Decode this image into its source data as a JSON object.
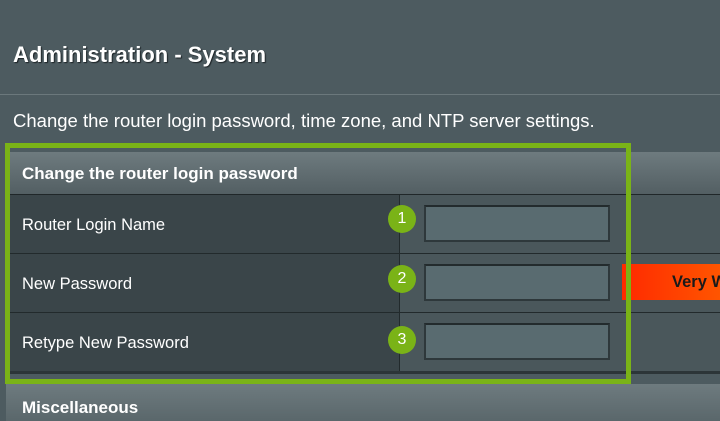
{
  "page": {
    "title": "Administration - System",
    "description": "Change the router login password, time zone, and NTP server settings."
  },
  "password_section": {
    "title": "Change the router login password",
    "rows": [
      {
        "label": "Router Login Name",
        "value": "",
        "step": "1"
      },
      {
        "label": "New Password",
        "value": "",
        "step": "2"
      },
      {
        "label": "Retype New Password",
        "value": "",
        "step": "3"
      }
    ],
    "strength_label": "Very Weak",
    "strength_color": "#ff3300"
  },
  "misc_section": {
    "title": "Miscellaneous"
  },
  "colors": {
    "background": "#4d5b60",
    "highlight": "#7ab317",
    "panel": "#2c3538"
  }
}
